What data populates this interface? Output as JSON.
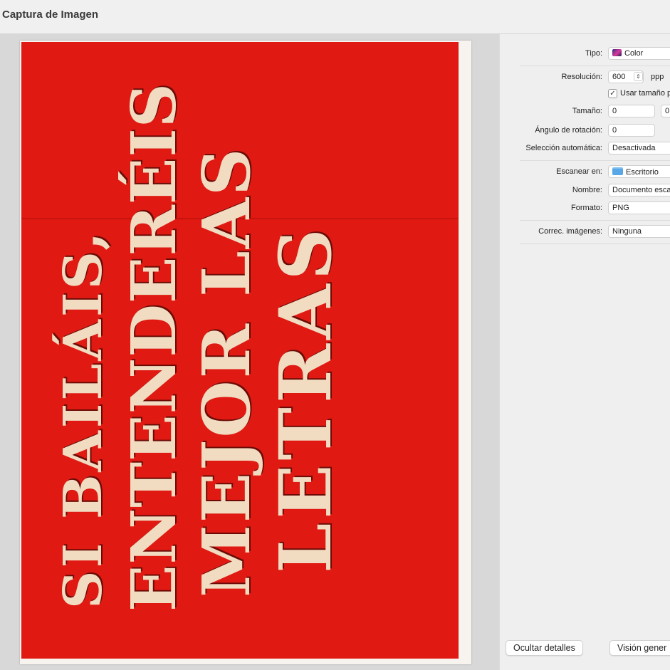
{
  "window": {
    "title": "Captura de Imagen"
  },
  "preview": {
    "artwork_text": [
      "SI BAILÁIS,",
      "ENTENDERÉIS",
      "MEJOR LAS",
      "LETRAS"
    ],
    "colors": {
      "page": "#e01a12",
      "letters": "#f1dcc2"
    }
  },
  "settings": {
    "tipo": {
      "label": "Tipo:",
      "value": "Color",
      "icon": "color-swatch-icon"
    },
    "resolucion": {
      "label": "Resolución:",
      "value": "600",
      "unit": "ppp"
    },
    "usar_tamano": {
      "label": "Usar tamaño p",
      "checked": true
    },
    "tamano": {
      "label": "Tamaño:",
      "width": "0",
      "height": "0"
    },
    "angulo": {
      "label": "Ángulo de rotación:",
      "value": "0"
    },
    "seleccion": {
      "label": "Selección automática:",
      "value": "Desactivada"
    },
    "escanear_en": {
      "label": "Escanear en:",
      "value": "Escritorio",
      "icon": "folder-icon"
    },
    "nombre": {
      "label": "Nombre:",
      "value": "Documento esca"
    },
    "formato": {
      "label": "Formato:",
      "value": "PNG"
    },
    "correc": {
      "label": "Correc. imágenes:",
      "value": "Ninguna"
    }
  },
  "buttons": {
    "hide_details": "Ocultar detalles",
    "overview": "Visión gener"
  }
}
